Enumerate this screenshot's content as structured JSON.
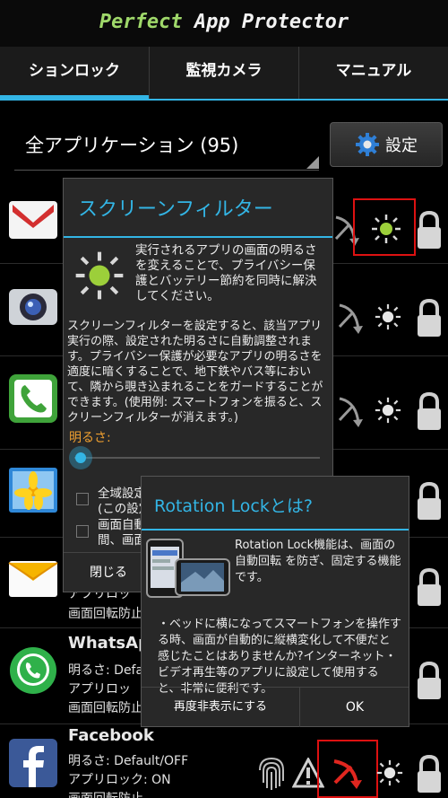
{
  "app": {
    "title_part1": "Perfect",
    "title_part2": "App Protector"
  },
  "tabs": [
    {
      "label": "ションロック"
    },
    {
      "label": "監視カメラ"
    },
    {
      "label": "マニュアル"
    }
  ],
  "filter": {
    "selected": "全アプリケーション (95)",
    "settings_label": "設定"
  },
  "apps": [
    {
      "name": "WhatsApp",
      "brightness": "明るさ: Default/OFF",
      "applock": "アプリロック: ON",
      "rotation": "画面回転防止: OFF"
    },
    {
      "name": "Facebook",
      "brightness": "明るさ: Default/OFF",
      "applock": "アプリロック: ON",
      "rotation": "画面回転防止: OFF"
    }
  ],
  "partial_rows": {
    "email_line1": "アプリロッ",
    "email_line2": "画面回転防止",
    "whatsapp_cut": "WhatsAp",
    "wa_line1": "明るさ: Defa",
    "wa_line2": "アプリロッ",
    "wa_line3": "画面回転防止",
    "fb_line1": "明るさ: Default/OFF",
    "fb_line2": "アプリロック: ON",
    "fb_line3": "画面回転防止"
  },
  "screen_filter_dialog": {
    "title": "スクリーンフィルター",
    "intro": "実行されるアプリの画面の明るさを変えることで、プライバシー保護とバッテリー節約を同時に解決してください。",
    "body": "スクリーンフィルターを設定すると、該当アプリ実行の際、設定された明るさに自動調整されます。プライバシー保護が必要なアプリの明るさを適度に暗くすることで、地下鉄やバス等において、隣から覗き込まれることをガードすることができます。(使用例: スマートフォンを振ると、スクリーンフィルターが消えます。)",
    "brightness_label": "明るさ:",
    "check1": "全域設定",
    "check1_sub": "(この設定",
    "check2": "画面自動",
    "check2_sub": "間、画面",
    "close": "閉じる"
  },
  "rotation_dialog": {
    "title": "Rotation Lockとは?",
    "text1": "Rotation Lock機能は、画面の自動回転 を防ぎ、固定する機能です。",
    "text2": "・ベッドに横になってスマートフォンを操作する時、画面が自動的に縦横変化して不便だと感じたことはありませんか?インターネット・ビデオ再生等のアプリに設定して使用すると、非常に便利です。",
    "dont_show": "再度非表示にする",
    "ok": "OK"
  },
  "colors": {
    "accent": "#33b5e5",
    "title_green": "#9fd86a",
    "highlight": "#d11111"
  }
}
